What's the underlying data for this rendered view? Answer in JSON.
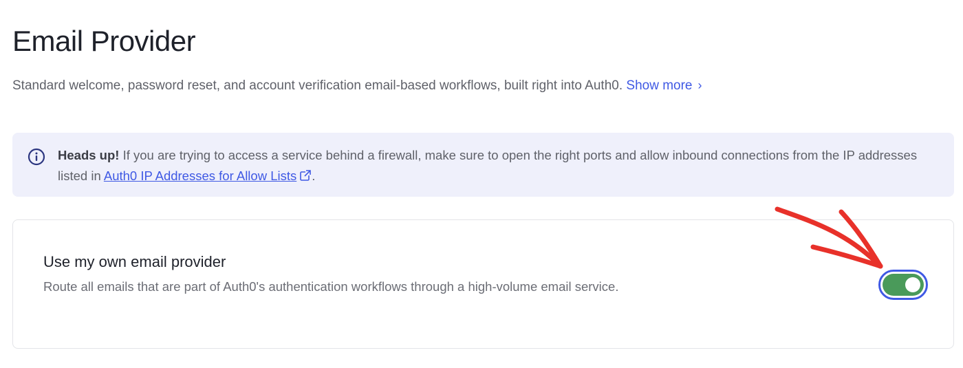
{
  "header": {
    "title": "Email Provider",
    "description": "Standard welcome, password reset, and account verification email-based workflows, built right into Auth0.",
    "show_more": "Show more",
    "show_more_icon": "chevron-right-icon"
  },
  "alert": {
    "icon": "info-icon",
    "bold": "Heads up!",
    "text": " If you are trying to access a service behind a firewall, make sure to open the right ports and allow inbound connections from the IP addresses listed in ",
    "link": "Auth0 IP Addresses for Allow Lists",
    "link_icon": "external-link-icon",
    "suffix": "."
  },
  "setting": {
    "title": "Use my own email provider",
    "description": "Route all emails that are part of Auth0's authentication workflows through a high-volume email service.",
    "toggle_on": true
  },
  "colors": {
    "accent": "#3f59e4",
    "toggle_on": "#4a9a5a",
    "alert_bg": "#eff0fb",
    "annotation_arrow": "#e8312a"
  }
}
